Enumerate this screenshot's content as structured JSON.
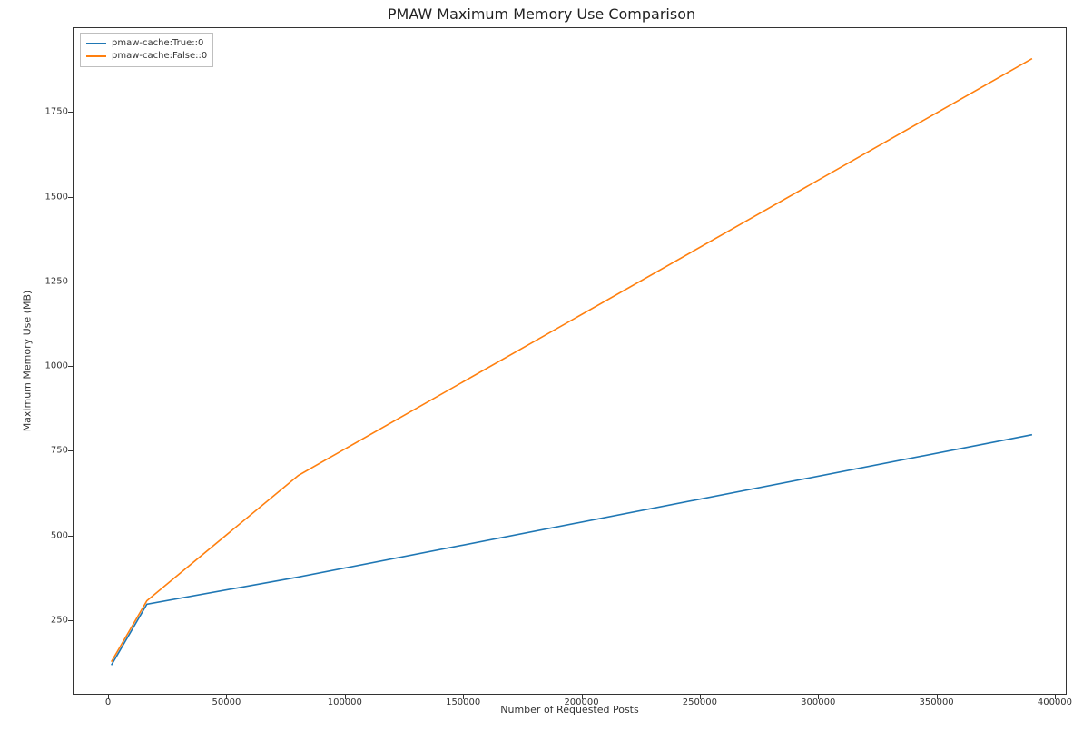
{
  "chart_data": {
    "type": "line",
    "title": "PMAW Maximum Memory Use Comparison",
    "xlabel": "Number of Requested Posts",
    "ylabel": "Maximum Memory Use (MB)",
    "xlim": [
      -15000,
      405000
    ],
    "ylim": [
      30,
      2000
    ],
    "x_ticks": [
      0,
      50000,
      100000,
      150000,
      200000,
      250000,
      300000,
      350000,
      400000
    ],
    "y_ticks": [
      250,
      500,
      750,
      1000,
      1250,
      1500,
      1750
    ],
    "x": [
      1000,
      16000,
      80000,
      390000
    ],
    "series": [
      {
        "name": "pmaw-cache:True::0",
        "color": "#1f77b4",
        "values": [
          120,
          300,
          380,
          800
        ]
      },
      {
        "name": "pmaw-cache:False::0",
        "color": "#ff7f0e",
        "values": [
          130,
          310,
          680,
          1910
        ]
      }
    ],
    "legend_position": "upper-left"
  }
}
